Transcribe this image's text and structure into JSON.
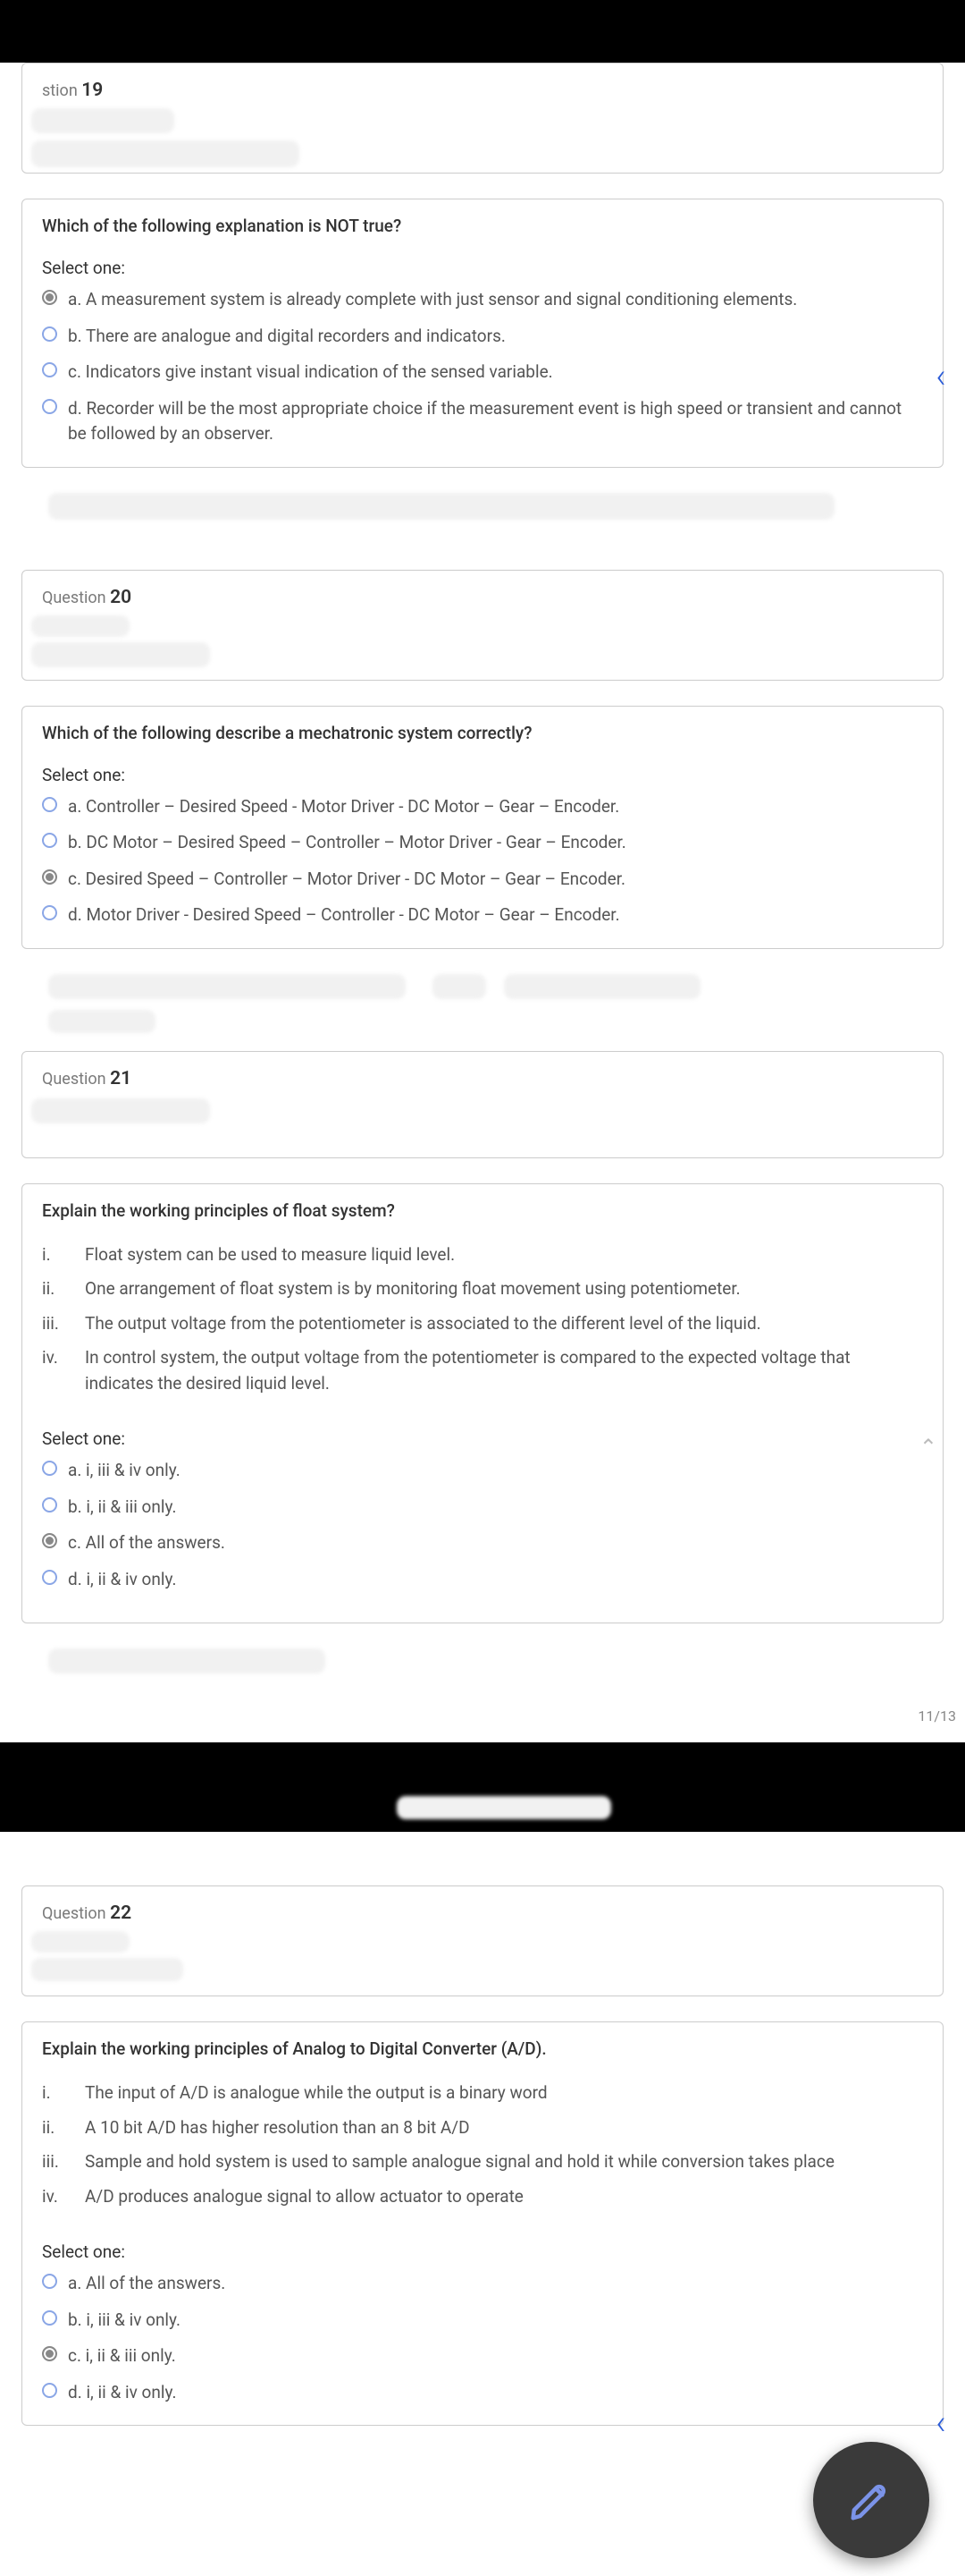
{
  "question_label": "Question",
  "select_one": "Select one:",
  "page_indicator": "11/13",
  "nav_chevron": "‹",
  "questions": [
    {
      "number": "19",
      "label_trunc": "stion",
      "text": "Which of the following explanation is NOT true?",
      "options": [
        {
          "selected": true,
          "text": "a. A measurement system is already complete with just sensor and signal conditioning elements."
        },
        {
          "selected": false,
          "text": "b. There are analogue and digital recorders and indicators."
        },
        {
          "selected": false,
          "text": "c. Indicators give instant visual indication of the sensed variable."
        },
        {
          "selected": false,
          "text": "d. Recorder will be the most appropriate choice if the measurement event is high speed or transient and cannot be followed by an observer."
        }
      ]
    },
    {
      "number": "20",
      "text": "Which of the following describe a mechatronic system correctly?",
      "options": [
        {
          "selected": false,
          "text": "a. Controller – Desired Speed - Motor Driver -  DC Motor – Gear – Encoder."
        },
        {
          "selected": false,
          "text": "b. DC Motor – Desired Speed – Controller – Motor Driver -  Gear – Encoder."
        },
        {
          "selected": true,
          "text": "c. Desired Speed – Controller – Motor Driver -  DC Motor – Gear – Encoder."
        },
        {
          "selected": false,
          "text": "d. Motor Driver - Desired Speed – Controller -  DC Motor – Gear – Encoder."
        }
      ]
    },
    {
      "number": "21",
      "text": "Explain the working principles of float system?",
      "statements": [
        {
          "rn": "i.",
          "t": "Float system can be used to measure liquid level."
        },
        {
          "rn": "ii.",
          "t": "One arrangement of float system is by monitoring float movement using potentiometer."
        },
        {
          "rn": "iii.",
          "t": "The output voltage from the potentiometer is associated to the different level of the liquid."
        },
        {
          "rn": "iv.",
          "t": "In control system, the output voltage from the potentiometer is compared to the expected voltage that indicates the desired liquid level."
        }
      ],
      "options": [
        {
          "selected": false,
          "text": "a. i, iii & iv only."
        },
        {
          "selected": false,
          "text": "b. i, ii & iii only."
        },
        {
          "selected": true,
          "text": "c. All of the answers."
        },
        {
          "selected": false,
          "text": "d. i, ii & iv only."
        }
      ]
    },
    {
      "number": "22",
      "text": "Explain the working principles of Analog to Digital Converter (A/D).",
      "statements": [
        {
          "rn": "i.",
          "t": "The input of A/D is analogue while the output is a binary word"
        },
        {
          "rn": "ii.",
          "t": "A 10 bit A/D has higher resolution than an 8 bit A/D"
        },
        {
          "rn": "iii.",
          "t": "Sample and hold system is used to sample analogue signal and hold it while conversion takes place"
        },
        {
          "rn": "iv.",
          "t": "A/D produces analogue signal to allow actuator to operate"
        }
      ],
      "options": [
        {
          "selected": false,
          "text": "a. All of the answers."
        },
        {
          "selected": false,
          "text": "b. i, iii & iv only."
        },
        {
          "selected": true,
          "text": "c. i, ii & iii only."
        },
        {
          "selected": false,
          "text": "d. i, ii & iv only."
        }
      ]
    }
  ]
}
